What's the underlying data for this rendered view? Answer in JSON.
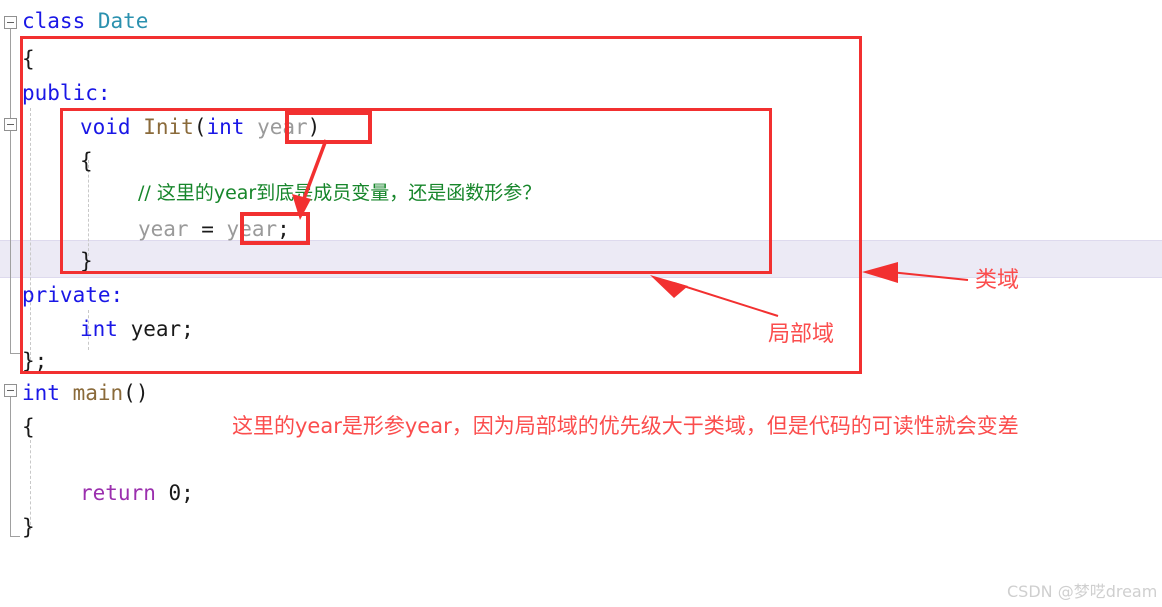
{
  "editor": {
    "language": "cpp",
    "colors": {
      "keyword": "#1a17e6",
      "type_name": "#2b91af",
      "function": "#8a6a3a",
      "comment": "#17862b",
      "grayed_identifier": "#9a9a9a",
      "return_keyword": "#9b2fae",
      "annotation_red": "#fb4d4d",
      "box_red": "#f23030",
      "current_line_highlight": "#eceaf5",
      "background": "#ffffff"
    },
    "lines": [
      {
        "id": "l1",
        "text": "class Date"
      },
      {
        "id": "l2",
        "text": "{"
      },
      {
        "id": "l3",
        "text": "public:"
      },
      {
        "id": "l4",
        "text": "    void Init(int year)"
      },
      {
        "id": "l5",
        "text": "    {"
      },
      {
        "id": "l6",
        "text": "        // 这里的year到底是成员变量，还是函数形参？"
      },
      {
        "id": "l7",
        "text": "        year = year;"
      },
      {
        "id": "l8",
        "text": "    }"
      },
      {
        "id": "l9",
        "text": "private:"
      },
      {
        "id": "l10",
        "text": "    int year;"
      },
      {
        "id": "l11",
        "text": "};"
      },
      {
        "id": "l12",
        "text": "int main()"
      },
      {
        "id": "l13",
        "text": "{"
      },
      {
        "id": "l14",
        "text": ""
      },
      {
        "id": "l15",
        "text": "    return 0;"
      },
      {
        "id": "l16",
        "text": "}"
      }
    ],
    "tokens": {
      "kw_class": "class",
      "name_date": "Date",
      "brace_open": "{",
      "kw_public": "public:",
      "kw_void": "void",
      "fn_init": "Init",
      "kw_int": "int",
      "param_year": "year",
      "paren_open": "(",
      "paren_close": ")",
      "comment_line": "// 这里的year到底是成员变量，还是函数形参？",
      "assign_lhs": "year",
      "assign_op": "=",
      "assign_rhs": "year",
      "semicolon": ";",
      "brace_close": "}",
      "kw_private": "private:",
      "member_year": "year",
      "class_end": "};",
      "fn_main": "main",
      "kw_return": "return",
      "literal_zero": "0",
      "empty": ""
    },
    "fold_markers": [
      {
        "id": "fold-class-date",
        "state": "expanded",
        "glyph": "minus"
      },
      {
        "id": "fold-init-method",
        "state": "expanded",
        "glyph": "minus"
      },
      {
        "id": "fold-main",
        "state": "expanded",
        "glyph": "minus"
      }
    ]
  },
  "annotations": {
    "class_scope_label": "类域",
    "local_scope_label": "局部域",
    "bottom_note": "这里的year是形参year，因为局部域的优先级大于类域，但是代码的可读性就会变差",
    "boxes": [
      {
        "id": "class-scope-box",
        "label": "类域"
      },
      {
        "id": "local-scope-box",
        "label": "局部域"
      },
      {
        "id": "param-year-box",
        "label": "year"
      },
      {
        "id": "assign-year-box",
        "label": "year"
      }
    ],
    "arrows": [
      {
        "id": "arrow-to-class-scope",
        "points_to": "类域"
      },
      {
        "id": "arrow-to-local-scope",
        "points_to": "局部域"
      },
      {
        "id": "arrow-param-to-assign",
        "points_to": "year"
      }
    ]
  },
  "watermark": {
    "text": "CSDN @梦呓dream"
  }
}
